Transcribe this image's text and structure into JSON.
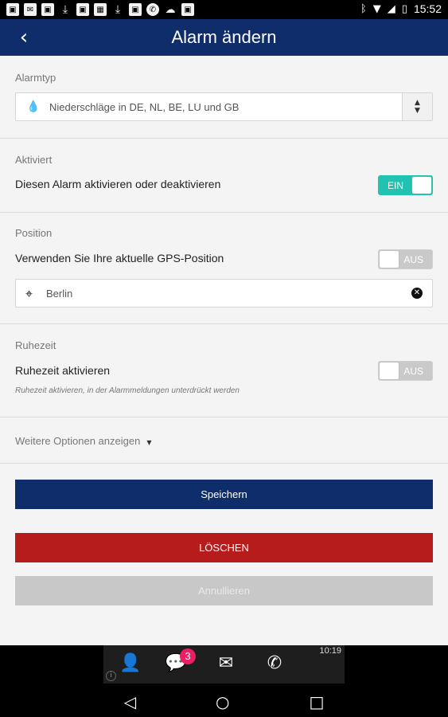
{
  "status_bar": {
    "time": "15:52",
    "left_icons": [
      "image-icon",
      "mail-icon",
      "image-icon",
      "download-icon",
      "image-icon",
      "photo-icon",
      "download-icon",
      "image-icon",
      "whatsapp-icon",
      "weather-icon",
      "image-icon"
    ],
    "right_icons": [
      "bluetooth-icon",
      "wifi-icon",
      "signal-icon",
      "battery-icon"
    ]
  },
  "app_bar": {
    "title": "Alarm ändern",
    "back_icon": "back-arrow-icon"
  },
  "alarm_type": {
    "label": "Alarmtyp",
    "value": "Niederschläge in DE, NL, BE, LU und GB",
    "icon": "drop-icon"
  },
  "activated": {
    "label": "Aktiviert",
    "text": "Diesen Alarm aktivieren oder deaktivieren",
    "toggle_label": "EIN",
    "toggle_state": "on"
  },
  "position": {
    "label": "Position",
    "text": "Verwenden Sie Ihre aktuelle GPS-Position",
    "toggle_label": "AUS",
    "toggle_state": "off",
    "location_value": "Berlin"
  },
  "quiet_time": {
    "label": "Ruhezeit",
    "text": "Ruhezeit aktivieren",
    "toggle_label": "AUS",
    "toggle_state": "off",
    "note": "Ruhezeit aktivieren, in der Alarmmeldungen unterdrückt werden"
  },
  "more_options": {
    "label": "Weitere Optionen anzeigen"
  },
  "buttons": {
    "save": "Speichern",
    "delete": "LÖSCHEN",
    "cancel": "Annullieren"
  },
  "dock": {
    "time": "10:19",
    "badge_count": "3",
    "icons": [
      "contacts-icon",
      "chat-icon",
      "mail-icon",
      "phone-icon"
    ]
  },
  "colors": {
    "primary": "#0f2d6a",
    "toggle_on": "#22c2b0",
    "delete": "#b71c1c",
    "badge": "#e91e63"
  }
}
